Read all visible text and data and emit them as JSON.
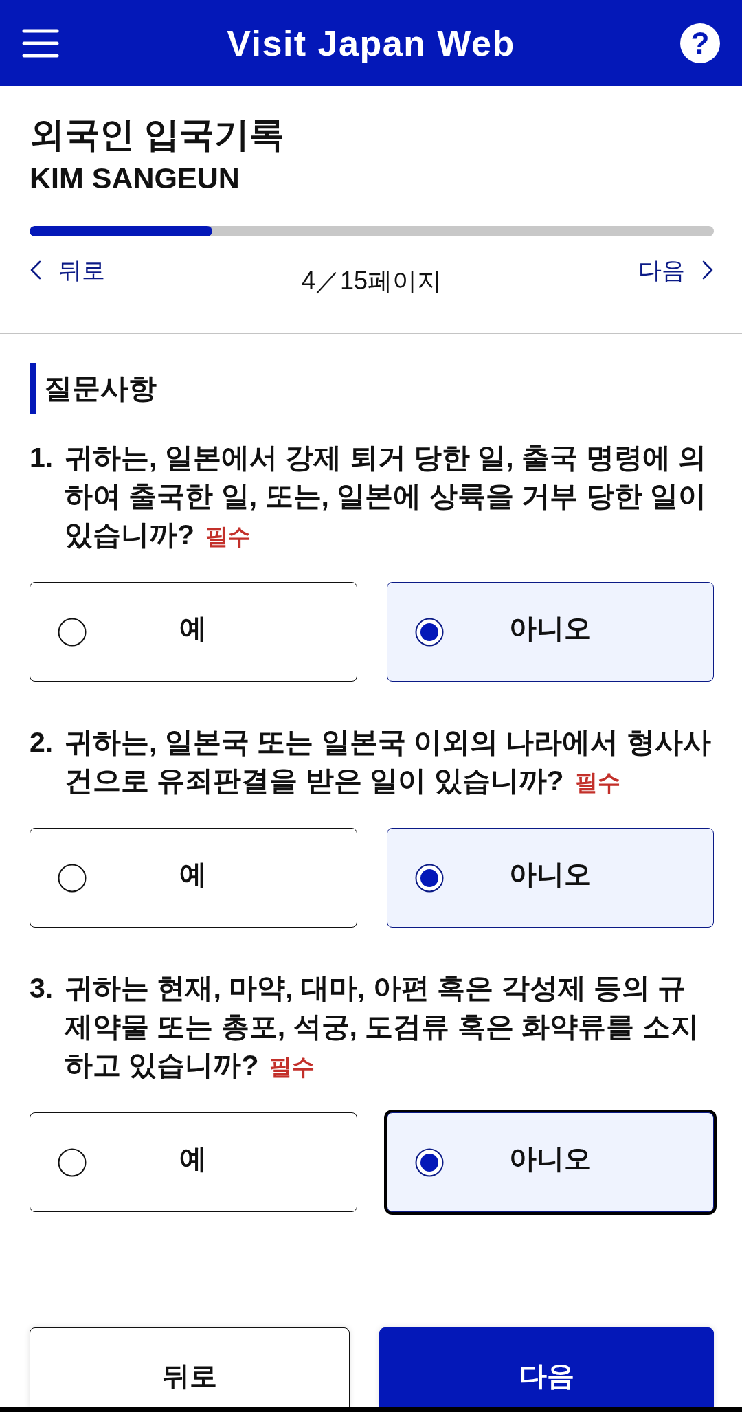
{
  "header": {
    "title": "Visit Japan Web",
    "help_label": "?"
  },
  "page": {
    "title": "외국인 입국기록",
    "name": "KIM SANGEUN"
  },
  "progress": {
    "level": 0.267,
    "back_label": "뒤로",
    "page_label": "4／15페이지",
    "next_label": "다음"
  },
  "section": {
    "title": "질문사항"
  },
  "questions": [
    {
      "number": "1.",
      "text": "귀하는, 일본에서 강제 퇴거 당한 일, 출국 명령에 의하여 출국한 일, 또는, 일본에 상륙을 거부 당한 일이 있습니까?",
      "required_label": "필수",
      "options": [
        {
          "label": "예",
          "selected": false,
          "focused": false
        },
        {
          "label": "아니오",
          "selected": true,
          "focused": false
        }
      ]
    },
    {
      "number": "2.",
      "text": "귀하는, 일본국 또는 일본국 이외의 나라에서 형사사건으로 유죄판결을 받은 일이 있습니까?",
      "required_label": "필수",
      "options": [
        {
          "label": "예",
          "selected": false,
          "focused": false
        },
        {
          "label": "아니오",
          "selected": true,
          "focused": false
        }
      ]
    },
    {
      "number": "3.",
      "text": "귀하는 현재, 마약, 대마, 아편 혹은 각성제 등의 규제약물 또는 총포, 석궁, 도검류 혹은 화약류를 소지하고 있습니까?",
      "required_label": "필수",
      "options": [
        {
          "label": "예",
          "selected": false,
          "focused": false
        },
        {
          "label": "아니오",
          "selected": true,
          "focused": true
        }
      ]
    }
  ],
  "footer": {
    "buttons": [
      {
        "label": "뒤로",
        "kind": "secondary"
      },
      {
        "label": "다음",
        "kind": "primary"
      }
    ]
  }
}
